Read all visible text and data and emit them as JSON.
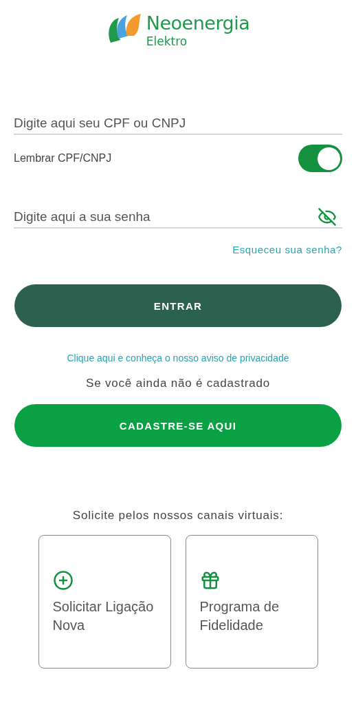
{
  "logo": {
    "brand": "Neoenergia",
    "sub": "Elektro"
  },
  "login": {
    "cpf_field": {
      "placeholder": "Digite aqui seu CPF ou CNPJ"
    },
    "remember": {
      "label": "Lembrar CPF/CNPJ",
      "on": true
    },
    "password_field": {
      "placeholder": "Digite aqui a sua senha",
      "visible": false
    },
    "forgot_link": "Esqueceu sua senha?",
    "submit_button": "ENTRAR"
  },
  "privacy_link": "Clique aqui e conheça o nosso aviso de privacidade",
  "not_registered": "Se você ainda não é cadastrado",
  "register_button": "CADASTRE-SE AQUI",
  "channels": {
    "title": "Solicite pelos nossos canais virtuais:",
    "cards": [
      {
        "kind": "add",
        "label": "Solicitar Ligação Nova"
      },
      {
        "kind": "gift",
        "label": "Programa de Fidelidade"
      }
    ]
  }
}
